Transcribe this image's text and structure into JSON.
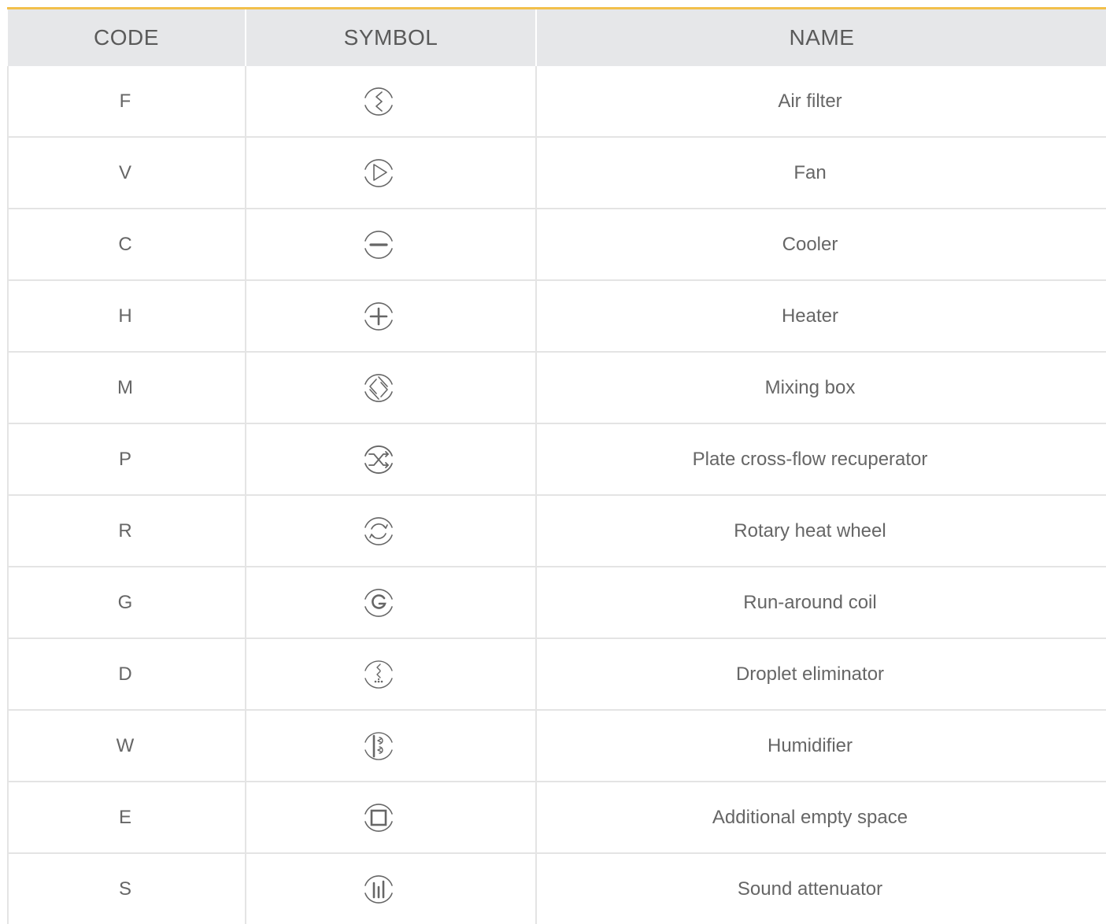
{
  "header": {
    "code": "CODE",
    "symbol": "SYMBOL",
    "name": "NAME"
  },
  "rows": [
    {
      "code": "F",
      "icon": "air-filter-icon",
      "name": "Air filter"
    },
    {
      "code": "V",
      "icon": "fan-icon",
      "name": "Fan"
    },
    {
      "code": "C",
      "icon": "cooler-icon",
      "name": "Cooler"
    },
    {
      "code": "H",
      "icon": "heater-icon",
      "name": "Heater"
    },
    {
      "code": "M",
      "icon": "mixing-box-icon",
      "name": "Mixing box"
    },
    {
      "code": "P",
      "icon": "plate-recuperator-icon",
      "name": "Plate cross-flow recuperator"
    },
    {
      "code": "R",
      "icon": "rotary-wheel-icon",
      "name": "Rotary heat wheel"
    },
    {
      "code": "G",
      "icon": "run-around-coil-icon",
      "name": "Run-around coil"
    },
    {
      "code": "D",
      "icon": "droplet-eliminator-icon",
      "name": "Droplet eliminator"
    },
    {
      "code": "W",
      "icon": "humidifier-icon",
      "name": "Humidifier"
    },
    {
      "code": "E",
      "icon": "empty-space-icon",
      "name": "Additional empty space"
    },
    {
      "code": "S",
      "icon": "sound-attenuator-icon",
      "name": "Sound attenuator"
    }
  ],
  "colors": {
    "accent": "#f2c04b",
    "header_bg": "#e6e7e9",
    "grid": "#e4e4e4",
    "text": "#666666"
  }
}
